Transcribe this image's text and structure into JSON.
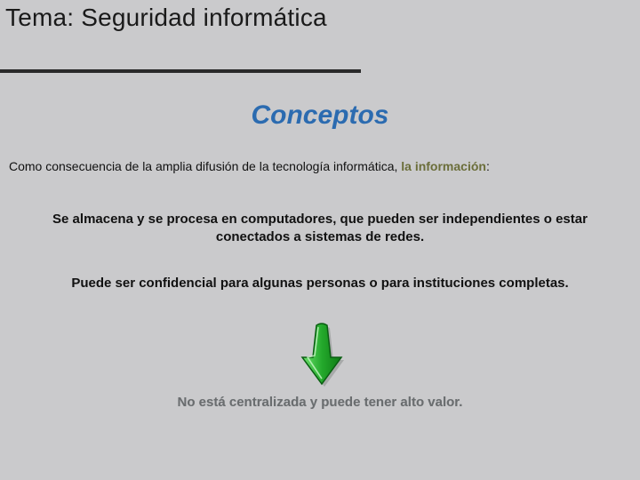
{
  "topic_prefix": "Tema: ",
  "topic_name": "Seguridad informática",
  "heading": "Conceptos",
  "intro_lead": "Como consecuencia de la amplia difusión de la tecnología informática, ",
  "intro_emph": "la información",
  "intro_tail": ":",
  "bullet1": "Se almacena y se procesa en computadores, que pueden ser independientes o estar conectados a sistemas de redes.",
  "bullet2": "Puede ser confidencial para algunas personas o para instituciones completas.",
  "bullet3": "No está centralizada y puede tener alto valor.",
  "colors": {
    "background": "#cacacc",
    "heading": "#2b6bb0",
    "emph": "#6b6e3a",
    "arrow_fill": "#2fb63a",
    "arrow_stroke": "#0a5f12",
    "muted_text": "#6a6d6f"
  }
}
